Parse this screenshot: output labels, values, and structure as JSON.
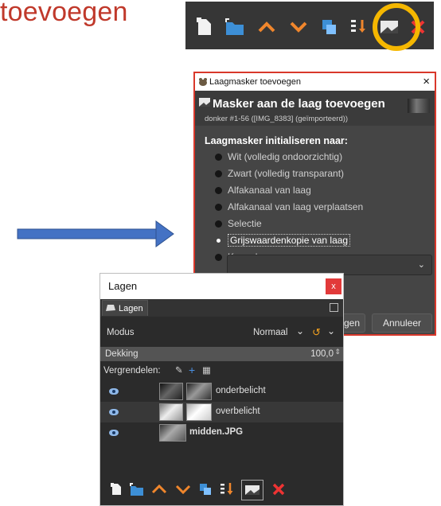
{
  "heading": "toevoegen",
  "toolbar": {
    "icons": [
      "new-layer-icon",
      "new-layer-group-icon",
      "raise-layer-icon",
      "lower-layer-icon",
      "duplicate-layer-icon",
      "anchor-merge-layer-icon",
      "add-layer-mask-icon",
      "delete-layer-icon"
    ],
    "highlight_color": "#f5b700"
  },
  "dialog": {
    "title": "Laagmasker toevoegen",
    "close": "×",
    "header_title": "Masker aan de laag toevoegen",
    "header_subtitle": "donker #1-56 ([IMG_8383] (geïmporteerd))",
    "init_label": "Laagmasker initialiseren naar:",
    "options": [
      "Wit (volledig ondoorzichtig)",
      "Zwart (volledig transparant)",
      "Alfakanaal van laag",
      "Alfakanaal van laag verplaatsen",
      "Selectie",
      "Grijswaardenkopie van laag",
      "Kanaal"
    ],
    "selected_option": "Grijswaardenkopie van laag",
    "add_button": "gen",
    "cancel_button": "Annuleer",
    "border_color": "#d9382b"
  },
  "layers_panel": {
    "title": "Lagen",
    "close": "x",
    "tab_label": "Lagen",
    "modus_label": "Modus",
    "modus_value": "Normaal",
    "dekking_label": "Dekking",
    "dekking_value": "100,0",
    "lock_label": "Vergrendelen:",
    "layers": [
      {
        "name": "onderbelicht",
        "visible": true,
        "has_mask": true
      },
      {
        "name": "overbelicht",
        "visible": true,
        "has_mask": true
      },
      {
        "name": "midden.JPG",
        "visible": true,
        "has_mask": false
      }
    ]
  },
  "colors": {
    "heading": "#c0392b",
    "arrow": "#4472c4",
    "dark_bg": "#2b2b2b"
  }
}
